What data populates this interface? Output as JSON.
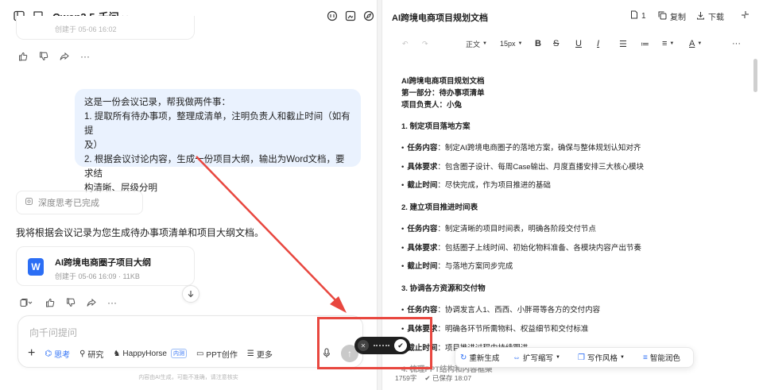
{
  "chat": {
    "model_name": "Qwen3.5-千问",
    "prev_card_meta": "创建于 05-06 16:02",
    "user_message": {
      "lines": [
        "这是一份会议记录，帮我做两件事：",
        "1. 提取所有待办事项，整理成清单，注明负责人和截止时间（如有提",
        "及）",
        "2. 根据会议讨论内容，生成一份项目大纲，输出为Word文档，要求结",
        "构清晰、层级分明"
      ]
    },
    "thinking_status": "深度思考已完成",
    "assistant_reply": "我将根据会议记录为您生成待办事项清单和项目大纲文档。",
    "doc_card": {
      "icon_letter": "W",
      "title": "AI跨境电商圈子项目大纲",
      "meta": "创建于 05-06 16:09 · 11KB"
    },
    "composer": {
      "placeholder": "向千问提问",
      "tools": {
        "think": "思考",
        "research": "研究",
        "happyhorse": "HappyHorse",
        "happyhorse_badge": "内测",
        "ppt": "PPT创作",
        "more": "更多"
      },
      "send_icon": "↑"
    },
    "disclaimer": "内容由AI生成，可能不准确，请注意核实"
  },
  "doc": {
    "header_title": "AI跨境电商项目规划文档",
    "page_count": "1",
    "copy_label": "复制",
    "download_label": "下载",
    "toolbar": {
      "style": "正文",
      "font_size": "15px",
      "bold": "B",
      "strike": "S",
      "underline": "U",
      "italic": "I",
      "text_color": "A"
    },
    "lines": {
      "l1": "AI跨境电商项目规划文档",
      "l2": "第一部分：待办事项清单",
      "l3": "项目负责人：小兔",
      "h1": "1. 制定项目落地方案",
      "h1_a_k": "任务内容",
      "h1_a_v": "：制定AI跨境电商圈子的落地方案，确保与整体规划认知对齐",
      "h1_b_k": "具体要求",
      "h1_b_v": "：包含圈子设计、每周Case输出、月度直播安排三大核心模块",
      "h1_c_k": "截止时间",
      "h1_c_v": "：尽快完成，作为项目推进的基础",
      "h2": "2. 建立项目推进时间表",
      "h2_a_k": "任务内容",
      "h2_a_v": "：制定清晰的项目时间表，明确各阶段交付节点",
      "h2_b_k": "具体要求",
      "h2_b_v": "：包括圈子上线时间、初始化物料准备、各模块内容产出节奏",
      "h2_c_k": "截止时间",
      "h2_c_v": "：与落地方案同步完成",
      "h3": "3. 协调各方资源和交付物",
      "h3_a_k": "任务内容",
      "h3_a_v": "：协调发言人1、西西、小胖哥等各方的交付内容",
      "h3_b_k": "具体要求",
      "h3_b_v": "：明确各环节所需物料、权益细节和交付标准",
      "h3_c_k": "截止时间",
      "h3_c_v": "：项目推进过程中持续跟进",
      "h4": "4. 梳理PPT结构和内容框架"
    },
    "ai_toolbar": {
      "regenerate": "重新生成",
      "expand": "扩写缩写",
      "style": "写作风格",
      "polish": "智能润色"
    },
    "footer": {
      "word_count": "1759字",
      "saved": "已保存 18:07"
    }
  },
  "colors": {
    "accent": "#2b6ef5",
    "annotation_red": "#e8473f",
    "user_bubble": "#eaf2fe"
  }
}
